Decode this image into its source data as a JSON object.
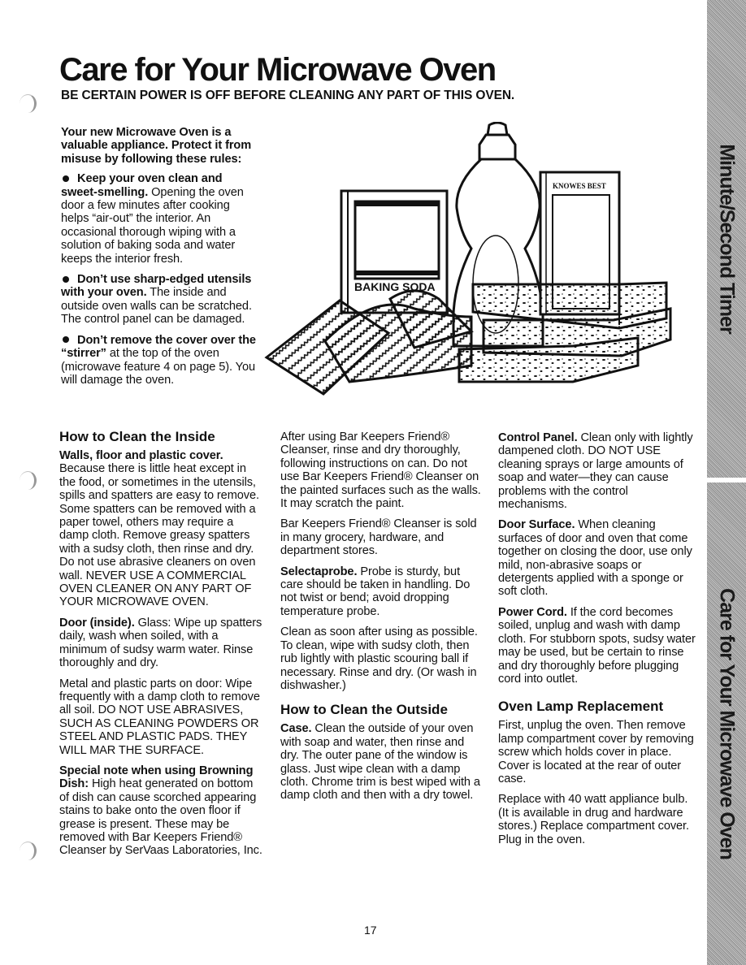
{
  "page": {
    "title": "Care for Your Microwave Oven",
    "warning": "BE CERTAIN POWER IS OFF BEFORE CLEANING ANY PART OF THIS OVEN.",
    "page_number": "17"
  },
  "side_tabs": [
    {
      "label": "Minute/Second Timer"
    },
    {
      "label": "Care for Your Microwave Oven"
    }
  ],
  "intro": {
    "lead": "Your new Microwave Oven is a valuable appliance. Protect it from misuse by following these rules:",
    "rules": [
      {
        "bold": "Keep your oven clean and sweet-smelling.",
        "text": " Opening the oven door a few minutes after cooking helps “air-out” the interior. An occasional thorough wiping with a solution of baking soda and water keeps the interior fresh."
      },
      {
        "bold": "Don’t use sharp-edged utensils with your oven.",
        "text": " The inside and outside oven walls can be scratched. The control panel can be damaged."
      },
      {
        "bold": "Don’t remove the cover over the “stirrer”",
        "text": " at the top of the oven (microwave feature 4 on page 5). You will damage the oven."
      }
    ]
  },
  "illustration": {
    "baking_soda_label": "BAKING SODA",
    "can_label": "KNOWES BEST"
  },
  "inside": {
    "heading": "How to Clean the Inside",
    "walls_bold": "Walls, floor and plastic cover.",
    "walls_text": " Because there is little heat except in the food, or sometimes in the utensils, spills and spatters are easy to remove. Some spatters can be removed with a paper towel, others may require a damp cloth. Remove greasy spatters with a sudsy cloth, then rinse and dry. Do not use abrasive cleaners on oven wall. NEVER USE A COMMERCIAL OVEN CLEANER ON ANY PART OF YOUR MICROWAVE OVEN.",
    "door_bold": "Door (inside).",
    "door_text": " Glass: Wipe up spatters daily, wash when soiled, with a minimum of sudsy warm water. Rinse thoroughly and dry.",
    "metal_text": "Metal and plastic parts on door: Wipe frequently with a damp cloth to remove all soil. DO NOT USE ABRASIVES, SUCH AS CLEANING POWDERS OR STEEL AND PLASTIC PADS. THEY WILL MAR THE SURFACE.",
    "browning_bold": "Special note when using Browning Dish:",
    "browning_text": " High heat generated on bottom of dish can cause scorched appearing stains to bake onto the oven floor if grease is present. These may be removed with Bar Keepers Friend® Cleanser by SerVaas Laboratories, Inc.",
    "after_text": "After using Bar Keepers Friend® Cleanser, rinse and dry thoroughly, following instructions on can. Do not use Bar Keepers Friend® Cleanser on the painted surfaces such as the walls. It may scratch the paint.",
    "sold_text": "Bar Keepers Friend® Cleanser is sold in many grocery, hardware, and department stores.",
    "probe_bold": "Selectaprobe.",
    "probe_text": " Probe is sturdy, but care should be taken in handling. Do not twist or bend; avoid dropping temperature probe.",
    "probe_clean_text": "Clean as soon after using as possible. To clean, wipe with sudsy cloth, then rub lightly with plastic scouring ball if necessary. Rinse and dry. (Or wash in dishwasher.)"
  },
  "outside": {
    "heading": "How to Clean the Outside",
    "case_bold": "Case.",
    "case_text": " Clean the outside of your oven with soap and water, then rinse and dry. The outer pane of the window is glass. Just wipe clean with a damp cloth. Chrome trim is best wiped with a damp cloth and then with a dry towel.",
    "control_bold": "Control Panel.",
    "control_text": " Clean only with lightly dampened cloth. DO NOT USE cleaning sprays or large amounts of soap and water—they can cause problems with the control mechanisms.",
    "door_bold": "Door Surface.",
    "door_text": " When cleaning surfaces of door and oven that come together on closing the door, use only mild, non-abrasive soaps or detergents applied with a sponge or soft cloth.",
    "cord_bold": "Power Cord.",
    "cord_text": " If the cord becomes soiled, unplug and wash with damp cloth. For stubborn spots, sudsy water may be used, but be certain to rinse and dry thoroughly before plugging cord into outlet."
  },
  "lamp": {
    "heading": "Oven Lamp Replacement",
    "text1": "First, unplug the oven. Then remove lamp compartment cover by removing screw which holds cover in place. Cover is located at the rear of outer case.",
    "text2": "Replace with 40 watt appliance bulb. (It is available in drug and hardware stores.) Replace compartment cover. Plug in the oven."
  }
}
